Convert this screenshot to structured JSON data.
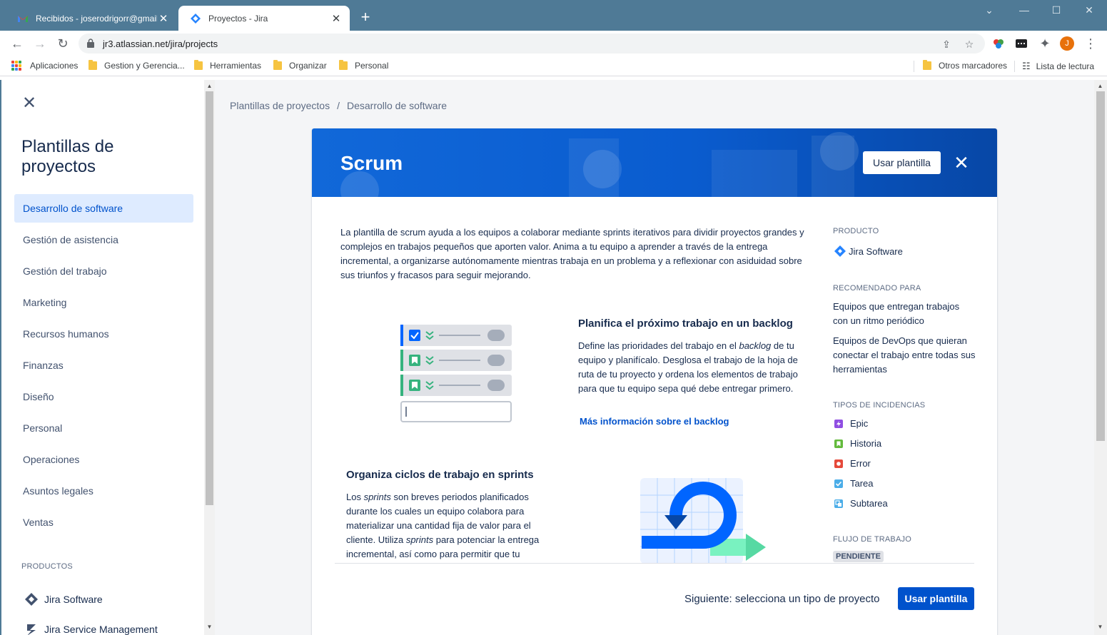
{
  "browser": {
    "tabs": [
      {
        "title": "Recibidos - joserodrigorr@gmail.",
        "close": "✕",
        "active": false
      },
      {
        "title": "Proyectos - Jira",
        "close": "✕",
        "active": true
      }
    ],
    "new_tab": "+",
    "url": "jr3.atlassian.net/jira/projects",
    "profile_initial": "J",
    "bookmarks": [
      {
        "label": "Aplicaciones",
        "type": "apps"
      },
      {
        "label": "Gestion y Gerencia...",
        "type": "folder"
      },
      {
        "label": "Herramientas",
        "type": "folder"
      },
      {
        "label": "Organizar",
        "type": "folder"
      },
      {
        "label": "Personal",
        "type": "folder"
      }
    ],
    "other_bookmarks": "Otros marcadores",
    "reading_list": "Lista de lectura"
  },
  "sidebar": {
    "title": "Plantillas de proyectos",
    "items": [
      {
        "label": "Desarrollo de software",
        "selected": true
      },
      {
        "label": "Gestión de asistencia"
      },
      {
        "label": "Gestión del trabajo"
      },
      {
        "label": "Marketing"
      },
      {
        "label": "Recursos humanos"
      },
      {
        "label": "Finanzas"
      },
      {
        "label": "Diseño"
      },
      {
        "label": "Personal"
      },
      {
        "label": "Operaciones"
      },
      {
        "label": "Asuntos legales"
      },
      {
        "label": "Ventas"
      }
    ],
    "products_heading": "PRODUCTOS",
    "products": [
      {
        "label": "Jira Software",
        "icon": "jira-software-icon"
      },
      {
        "label": "Jira Service Management",
        "icon": "jira-service-management-icon"
      }
    ]
  },
  "breadcrumb": {
    "parent": "Plantillas de proyectos",
    "separator": "/",
    "current": "Desarrollo de software"
  },
  "template": {
    "title": "Scrum",
    "use_button": "Usar plantilla",
    "description": "La plantilla de scrum ayuda a los equipos a colaborar mediante sprints iterativos para dividir proyectos grandes y complejos en trabajos pequeños que aporten valor. Anima a tu equipo a aprender a través de la entrega incremental, a organizarse autónomamente mientras trabaja en un problema y a reflexionar con asiduidad sobre sus triunfos y fracasos para seguir mejorando.",
    "feature_backlog": {
      "title": "Planifica el próximo trabajo en un backlog",
      "text_a": "Define las prioridades del trabajo en el ",
      "text_em": "backlog",
      "text_b": " de tu equipo y planifícalo. Desglosa el trabajo de la hoja de ruta de tu proyecto y ordena los elementos de trabajo para que tu equipo sepa qué debe entregar primero.",
      "link": "Más información sobre el backlog"
    },
    "feature_sprints": {
      "title": "Organiza ciclos de trabajo en sprints",
      "text_a": "Los ",
      "text_em1": "sprints",
      "text_b": " son breves periodos planificados durante los cuales un equipo colabora para materializar una cantidad fija de valor para el cliente. Utiliza ",
      "text_em2": "sprints",
      "text_c": " para potenciar la entrega incremental, así como para permitir que tu"
    }
  },
  "meta": {
    "product_heading": "PRODUCTO",
    "product": "Jira Software",
    "recommended_heading": "RECOMENDADO PARA",
    "recommended": [
      "Equipos que entregan trabajos con un ritmo periódico",
      "Equipos de DevOps que quieran conectar el trabajo entre todas sus herramientas"
    ],
    "issue_types_heading": "TIPOS DE INCIDENCIAS",
    "issue_types": [
      {
        "label": "Epic",
        "color": "#904ee2",
        "icon": "epic-icon"
      },
      {
        "label": "Historia",
        "color": "#63ba3c",
        "icon": "story-icon"
      },
      {
        "label": "Error",
        "color": "#e5493a",
        "icon": "bug-icon"
      },
      {
        "label": "Tarea",
        "color": "#4bade8",
        "icon": "task-icon"
      },
      {
        "label": "Subtarea",
        "color": "#4bade8",
        "icon": "subtask-icon"
      }
    ],
    "workflow_heading": "FLUJO DE TRABAJO",
    "workflow_first_status": "PENDIENTE"
  },
  "footer": {
    "next_text": "Siguiente: selecciona un tipo de proyecto",
    "button": "Usar plantilla"
  },
  "colors": {
    "primary": "#0052cc",
    "selected_bg": "#deebff",
    "browser_frame": "#4f7a96"
  }
}
